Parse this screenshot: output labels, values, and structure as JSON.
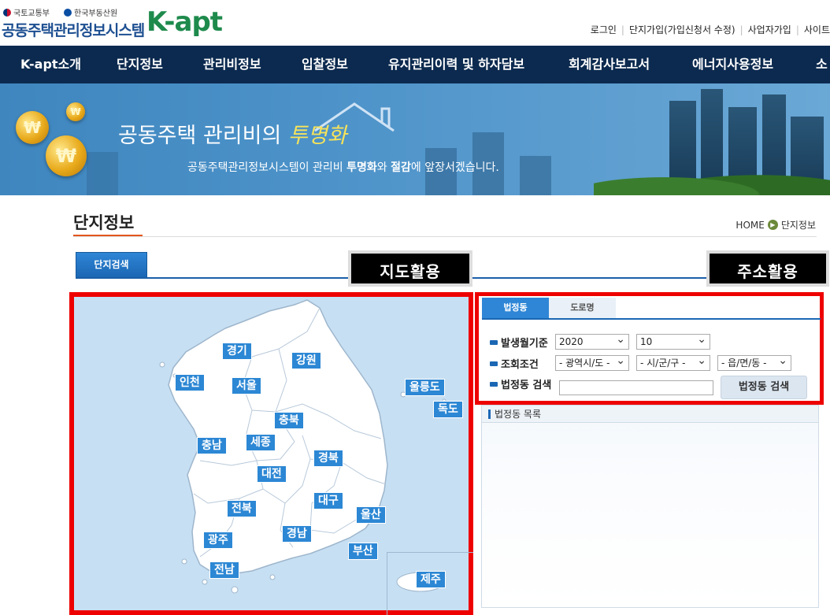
{
  "header": {
    "gov_logo_1": "국토교통부",
    "gov_logo_2": "한국부동산원",
    "site_name": "공동주택관리정보시스템",
    "brand": "K-apt",
    "util_links": [
      "로그인",
      "단지가입(가입신청서 수정)",
      "사업자가입",
      "사이트"
    ]
  },
  "gnb": [
    "K-apt소개",
    "단지정보",
    "관리비정보",
    "입찰정보",
    "유지관리이력 및 하자담보",
    "회계감사보고서",
    "에너지사용정보",
    "소"
  ],
  "banner": {
    "title_prefix": "공동주택 관리비의 ",
    "title_highlight": "투명화",
    "sub_1": "공동주택관리정보시스템이 관리비 ",
    "sub_b1": "투명화",
    "sub_2": "와 ",
    "sub_b2": "절감",
    "sub_3": "에 앞장서겠습니다.",
    "coin_symbol": "₩"
  },
  "page": {
    "title": "단지정보",
    "breadcrumb_home": "HOME",
    "breadcrumb_current": "단지정보",
    "search_tab": "단지검색",
    "map_label": "지도활용",
    "addr_label": "주소활용"
  },
  "map": {
    "regions": [
      "경기",
      "강원",
      "인천",
      "서울",
      "울릉도",
      "독도",
      "충북",
      "세종",
      "충남",
      "경북",
      "대전",
      "대구",
      "전북",
      "울산",
      "경남",
      "광주",
      "부산",
      "전남",
      "제주"
    ]
  },
  "address": {
    "tabs": [
      "법정동",
      "도로명"
    ],
    "row1_label": "발생월기준",
    "year": "2020",
    "month": "10",
    "row2_label": "조회조건",
    "sido_placeholder": "- 광역시/도 -",
    "sigungu_placeholder": "- 시/군/구 -",
    "emd_placeholder": "- 읍/면/동 -",
    "row3_label": "법정동 검색",
    "search_button": "법정동 검색",
    "list_title": "법정동 목록"
  },
  "colors": {
    "nav_bg": "#0c2a4f",
    "accent_blue": "#2c87d4",
    "highlight_red": "#e00000",
    "brand_green": "#1e8a4c"
  }
}
